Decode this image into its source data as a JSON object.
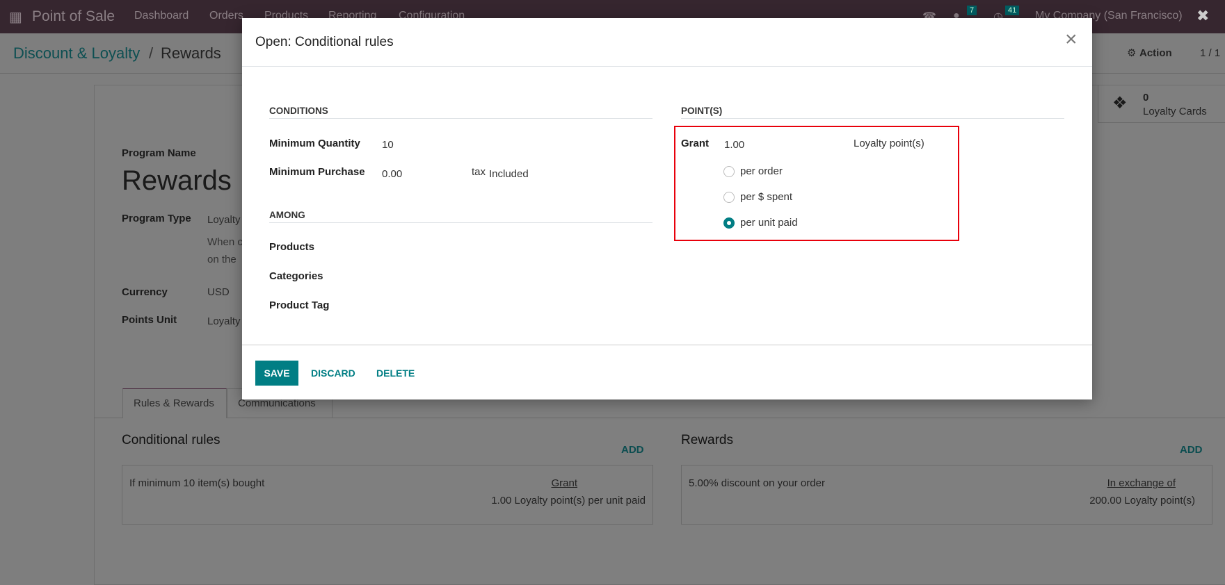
{
  "navbar": {
    "app_name": "Point of Sale",
    "menu": [
      "Dashboard",
      "Orders",
      "Products",
      "Reporting",
      "Configuration"
    ],
    "messages_count": "7",
    "activities_count": "41",
    "company": "My Company (San Francisco)"
  },
  "breadcrumb": {
    "parent": "Discount & Loyalty",
    "separator": "/",
    "current": "Rewards"
  },
  "control": {
    "action_label": "Action",
    "pager": "1 / 1"
  },
  "stat_button": {
    "count": "0",
    "label": "Loyalty Cards"
  },
  "form": {
    "program_name_label": "Program Name",
    "program_name": "Rewards",
    "program_type_label": "Program Type",
    "program_type": "Loyalty",
    "program_type_help_1": "When c",
    "program_type_help_2": "on the",
    "currency_label": "Currency",
    "currency": "USD",
    "points_unit_label": "Points Unit",
    "points_unit": "Loyalty"
  },
  "tabs": [
    "Rules & Rewards",
    "Communications"
  ],
  "rules": {
    "title": "Conditional rules",
    "add": "ADD",
    "condition": "If minimum 10 item(s) bought",
    "grant_label": "Grant",
    "grant_value": "1.00 Loyalty point(s) per unit paid"
  },
  "rewards": {
    "title": "Rewards",
    "add": "ADD",
    "description": "5.00% discount on your order",
    "exchange_label": "In exchange of",
    "exchange_value": "200.00 Loyalty point(s)"
  },
  "dialog": {
    "title": "Open: Conditional rules",
    "conditions": {
      "header": "CONDITIONS",
      "min_qty_label": "Minimum Quantity",
      "min_qty": "10",
      "min_purchase_label": "Minimum Purchase",
      "min_purchase": "0.00",
      "tax_mode_prefix": "tax",
      "tax_mode": "Included"
    },
    "among": {
      "header": "AMONG",
      "products_label": "Products",
      "categories_label": "Categories",
      "product_tag_label": "Product Tag"
    },
    "points": {
      "header": "POINT(S)",
      "grant_label": "Grant",
      "grant_value": "1.00",
      "unit": "Loyalty point(s)",
      "options": [
        "per order",
        "per $ spent",
        "per unit paid"
      ],
      "selected": "per unit paid"
    },
    "buttons": {
      "save": "SAVE",
      "discard": "DISCARD",
      "delete": "DELETE"
    },
    "highlight_color": "#e8000b",
    "accent_color": "#017e84"
  }
}
